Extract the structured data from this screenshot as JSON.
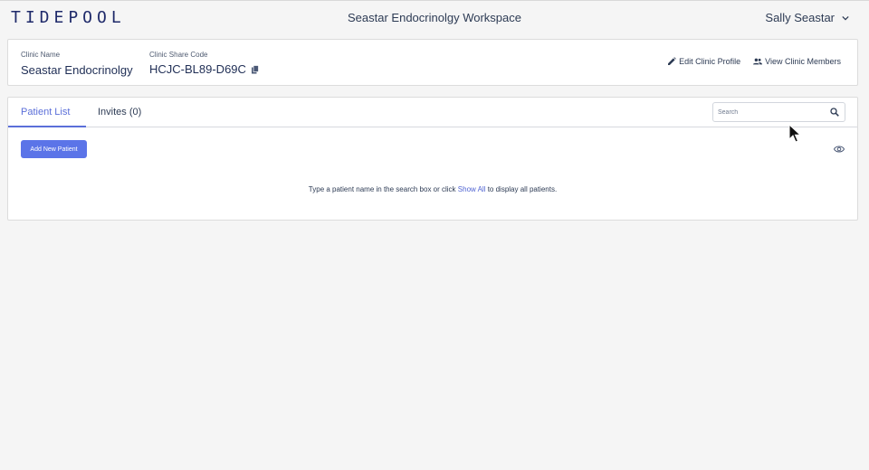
{
  "header": {
    "logo_text": "TIDEPOOL",
    "workspace_title": "Seastar Endocrinolgy Workspace",
    "user_name": "Sally Seastar"
  },
  "clinic": {
    "name_label": "Clinic Name",
    "name_value": "Seastar Endocrinolgy",
    "code_label": "Clinic Share Code",
    "code_value": "HCJC-BL89-D69C",
    "edit_profile_label": "Edit Clinic Profile",
    "view_members_label": "View Clinic Members"
  },
  "patients": {
    "tabs": [
      {
        "label": "Patient List",
        "active": true
      },
      {
        "label": "Invites (0)",
        "active": false
      }
    ],
    "search_placeholder": "Search",
    "add_button_label": "Add New Patient",
    "hint_before": "Type a patient name in the search box or click ",
    "hint_link": "Show All",
    "hint_after": " to display all patients."
  },
  "colors": {
    "accent": "#5b74e8",
    "text": "#2d3b54",
    "logo": "#1f2a6a"
  },
  "icons": [
    "copy-icon",
    "pencil-icon",
    "people-icon",
    "search-icon",
    "eye-icon",
    "chevron-down-icon"
  ]
}
